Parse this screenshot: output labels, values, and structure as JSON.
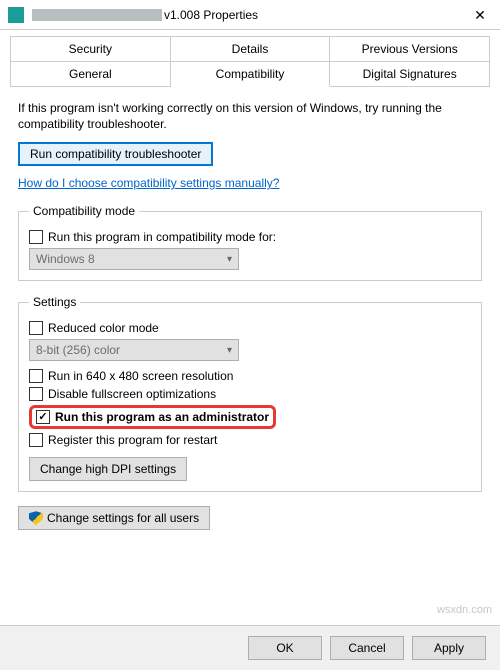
{
  "window": {
    "title_suffix": "v1.008 Properties"
  },
  "tabs": {
    "row1": [
      "Security",
      "Details",
      "Previous Versions"
    ],
    "row2": [
      "General",
      "Compatibility",
      "Digital Signatures"
    ],
    "active": "Compatibility"
  },
  "intro": "If this program isn't working correctly on this version of Windows, try running the compatibility troubleshooter.",
  "troubleshooter_btn": "Run compatibility troubleshooter",
  "help_link": "How do I choose compatibility settings manually?",
  "compat_mode": {
    "legend": "Compatibility mode",
    "checkbox": "Run this program in compatibility mode for:",
    "selected": "Windows 8"
  },
  "settings": {
    "legend": "Settings",
    "reduced_color": "Reduced color mode",
    "color_selected": "8-bit (256) color",
    "run_640": "Run in 640 x 480 screen resolution",
    "disable_fullscreen": "Disable fullscreen optimizations",
    "run_admin": "Run this program as an administrator",
    "register_restart": "Register this program for restart",
    "dpi_btn": "Change high DPI settings"
  },
  "all_users_btn": "Change settings for all users",
  "buttons": {
    "ok": "OK",
    "cancel": "Cancel",
    "apply": "Apply"
  },
  "watermark": "wsxdn.com"
}
